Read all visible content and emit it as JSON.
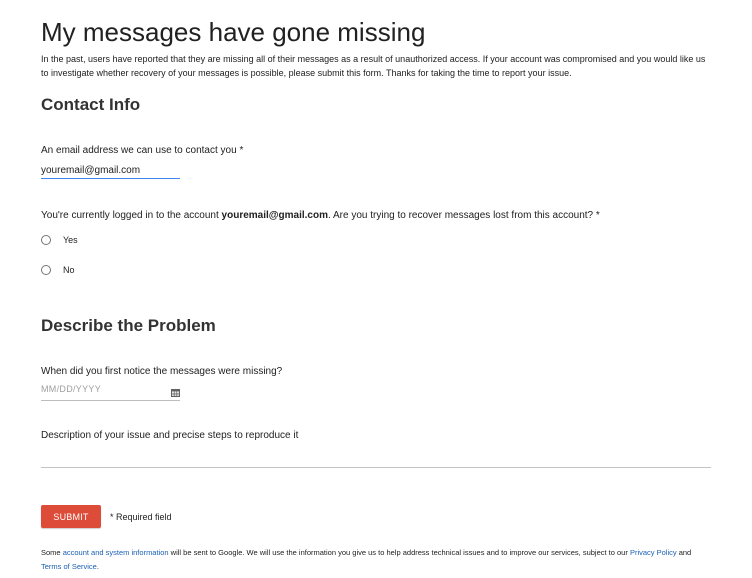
{
  "page": {
    "title": "My messages have gone missing",
    "intro": "In the past, users have reported that they are missing all of their messages as a result of unauthorized access. If your account was compromised and you would like us to investigate whether recovery of your messages is possible, please submit this form. Thanks for taking the time to report your issue."
  },
  "contact": {
    "heading": "Contact Info",
    "email_label": "An email address we can use to contact you *",
    "email_value": "youremail@gmail.com",
    "question_prefix": "You're currently logged in to the account ",
    "question_account": "youremail@gmail.com",
    "question_suffix": ". Are you trying to recover messages lost from this account? *",
    "options": [
      {
        "label": "Yes"
      },
      {
        "label": "No"
      }
    ]
  },
  "problem": {
    "heading": "Describe the Problem",
    "date_label": "When did you first notice the messages were missing?",
    "date_placeholder": "MM/DD/YYYY",
    "description_label": "Description of your issue and precise steps to reproduce it",
    "description_value": ""
  },
  "actions": {
    "submit_label": "SUBMIT",
    "required_note": "* Required field"
  },
  "footer": {
    "text_1": "Some ",
    "link_account_info": "account and system information",
    "text_2": " will be sent to Google. We will use the information you give us to help address technical issues and to improve our services, subject to our ",
    "link_privacy": "Privacy Policy",
    "text_3": " and ",
    "link_terms": "Terms of Service",
    "text_4": "."
  },
  "colors": {
    "submit_bg": "#dd4b39",
    "input_focus": "#4285f4",
    "link": "#1a5fb4"
  },
  "icons": {
    "date_picker": "calendar-icon"
  }
}
